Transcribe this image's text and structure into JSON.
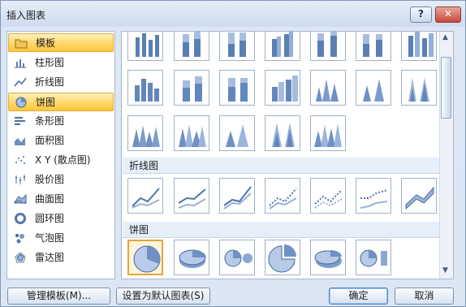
{
  "window": {
    "title": "插入图表",
    "help_label": "?",
    "close_label": "✕"
  },
  "sidebar": {
    "items": [
      {
        "label": "模板",
        "icon": "folder-icon",
        "selected": true
      },
      {
        "label": "柱形图",
        "icon": "column-chart-icon"
      },
      {
        "label": "折线图",
        "icon": "line-chart-icon"
      },
      {
        "label": "饼图",
        "icon": "pie-chart-icon",
        "selected": true
      },
      {
        "label": "条形图",
        "icon": "bar-chart-icon"
      },
      {
        "label": "面积图",
        "icon": "area-chart-icon"
      },
      {
        "label": "X Y (散点图)",
        "icon": "scatter-chart-icon"
      },
      {
        "label": "股价图",
        "icon": "stock-chart-icon"
      },
      {
        "label": "曲面图",
        "icon": "surface-chart-icon"
      },
      {
        "label": "圆环图",
        "icon": "doughnut-chart-icon"
      },
      {
        "label": "气泡图",
        "icon": "bubble-chart-icon"
      },
      {
        "label": "雷达图",
        "icon": "radar-chart-icon"
      }
    ]
  },
  "gallery": {
    "sections": [
      {
        "title": "折线图"
      },
      {
        "title": "饼图"
      }
    ]
  },
  "footer": {
    "manage_templates": "管理模板(M)...",
    "set_default": "设置为默认图表(S)",
    "ok": "确定",
    "cancel": "取消"
  }
}
